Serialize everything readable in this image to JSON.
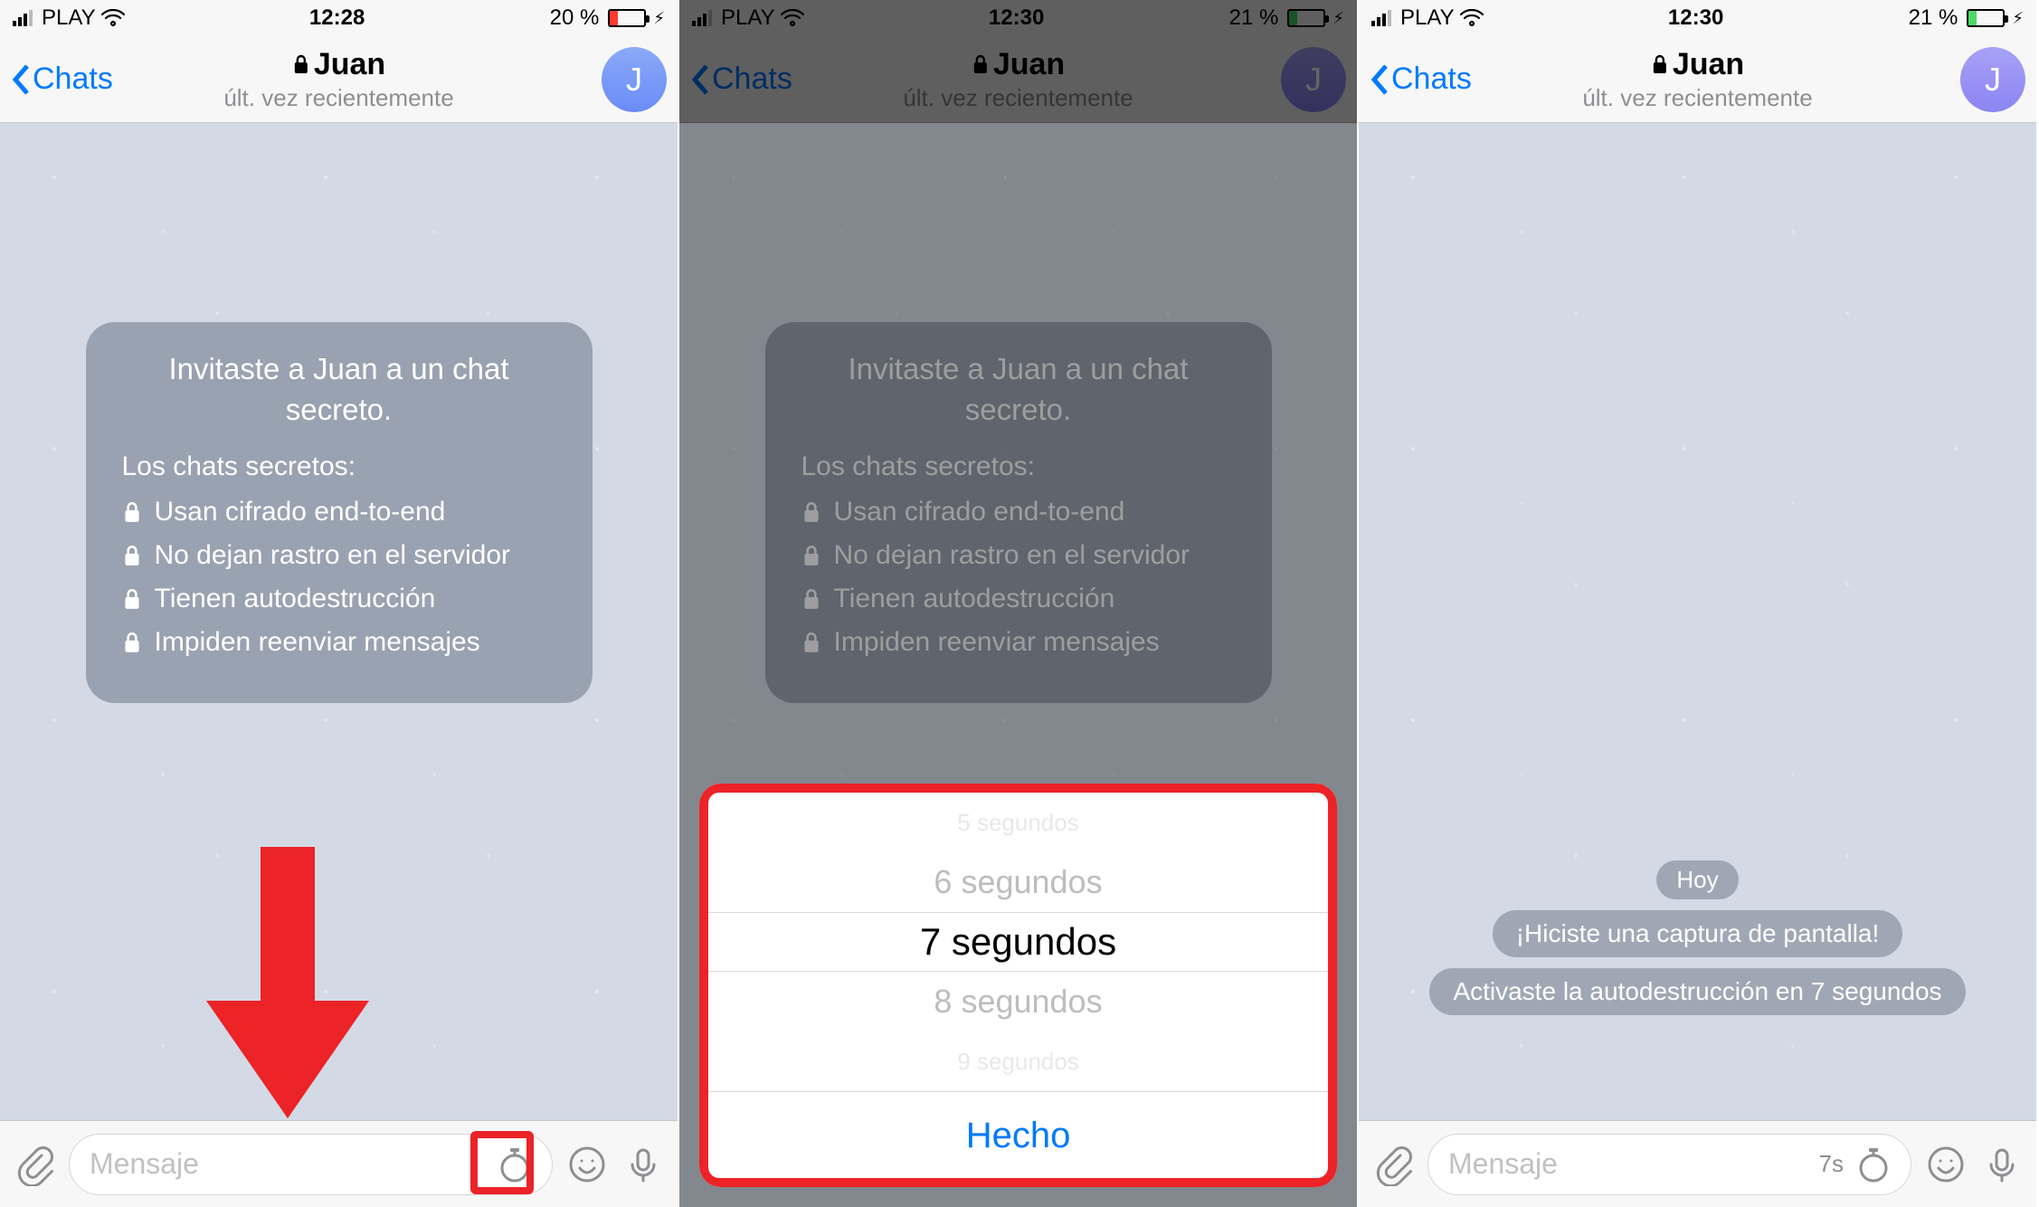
{
  "screens": [
    {
      "status": {
        "carrier": "PLAY",
        "time": "12:28",
        "battery_pct": "20 %",
        "battery_state": "red"
      },
      "header": {
        "back_label": "Chats",
        "contact": "Juan",
        "subtitle": "últ. vez recientemente",
        "avatar_letter": "J",
        "avatar_style": "blue"
      },
      "info_bubble": {
        "title_line1": "Invitaste a Juan a un chat",
        "title_line2": "secreto.",
        "list_label": "Los chats secretos:",
        "items": [
          "Usan cifrado end-to-end",
          "No dejan rastro en el servidor",
          "Tienen autodestrucción",
          "Impiden reenviar mensajes"
        ]
      },
      "toolbar": {
        "placeholder": "Mensaje",
        "timer_badge": ""
      },
      "annotations": {
        "arrow": true,
        "red_box_target": "timer-in-input"
      }
    },
    {
      "status": {
        "carrier": "PLAY",
        "time": "12:30",
        "battery_pct": "21 %",
        "battery_state": "green"
      },
      "header": {
        "back_label": "Chats",
        "contact": "Juan",
        "subtitle": "últ. vez recientemente",
        "avatar_letter": "J",
        "avatar_style": "violet"
      },
      "info_bubble": {
        "title_line1": "Invitaste a Juan a un chat",
        "title_line2": "secreto.",
        "list_label": "Los chats secretos:",
        "items": [
          "Usan cifrado end-to-end",
          "No dejan rastro en el servidor",
          "Tienen autodestrucción",
          "Impiden reenviar mensajes"
        ]
      },
      "picker": {
        "options": [
          "5 segundos",
          "6 segundos",
          "7 segundos",
          "8 segundos",
          "9 segundos"
        ],
        "selected_index": 2,
        "done_label": "Hecho"
      }
    },
    {
      "status": {
        "carrier": "PLAY",
        "time": "12:30",
        "battery_pct": "21 %",
        "battery_state": "green"
      },
      "header": {
        "back_label": "Chats",
        "contact": "Juan",
        "subtitle": "últ. vez recientemente",
        "avatar_letter": "J",
        "avatar_style": "violet"
      },
      "pills": {
        "date": "Hoy",
        "lines": [
          "¡Hiciste una captura de pantalla!",
          "Activaste la autodestrucción en 7 segundos"
        ]
      },
      "toolbar": {
        "placeholder": "Mensaje",
        "timer_badge": "7s"
      }
    }
  ]
}
